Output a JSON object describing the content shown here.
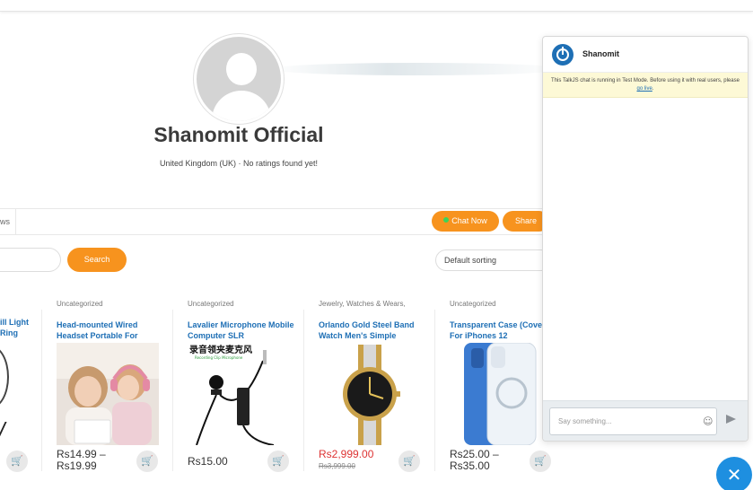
{
  "store": {
    "name": "Shanomit Official",
    "meta": "United Kingdom (UK) · No ratings found yet!"
  },
  "tabs": {
    "partial_label": "ws"
  },
  "actions": {
    "chat_now": "Chat Now",
    "share": "Share"
  },
  "search": {
    "button": "Search",
    "placeholder": ""
  },
  "sorting": {
    "selected": "Default sorting"
  },
  "partial_product": {
    "name_line1": "ill Light",
    "name_line2": "Ring"
  },
  "products": [
    {
      "category": "Uncategorized",
      "name": "Head-mounted Wired Headset Portable For",
      "price": "Rs14.99 –",
      "price2": "Rs19.99",
      "old_price": ""
    },
    {
      "category": "Uncategorized",
      "name": "Lavalier Microphone Mobile Computer SLR",
      "price": "Rs15.00",
      "price2": "",
      "old_price": ""
    },
    {
      "category": "Jewelry, Watches & Wears,",
      "name": "Orlando Gold Steel Band Watch Men's Simple",
      "price": "Rs2,999.00",
      "price2": "",
      "old_price": "Rs3,999.00"
    },
    {
      "category": "Uncategorized",
      "name": "Transparent Case (Cover) For iPhones 12",
      "price": "Rs25.00 –",
      "price2": "Rs35.00",
      "old_price": ""
    }
  ],
  "mic_caption": "录音领夹麦克风",
  "mic_sub": "Recording Clip Microphone",
  "chat": {
    "title": "Shanomit",
    "notice": "This TalkJS chat is running in Test Mode. Before using it with real users, please",
    "notice_link": "go live",
    "notice_end": ".",
    "input_placeholder": "Say something..."
  },
  "icons": {
    "chat_logo": "power-icon",
    "emoji": "smiley-icon",
    "send": "send-icon",
    "launcher": "close-icon",
    "cart": "cart-icon"
  },
  "colors": {
    "accent": "#f7931e",
    "link": "#1e6fb5",
    "sale": "#dd3333",
    "launcher": "#1e8fe0"
  }
}
